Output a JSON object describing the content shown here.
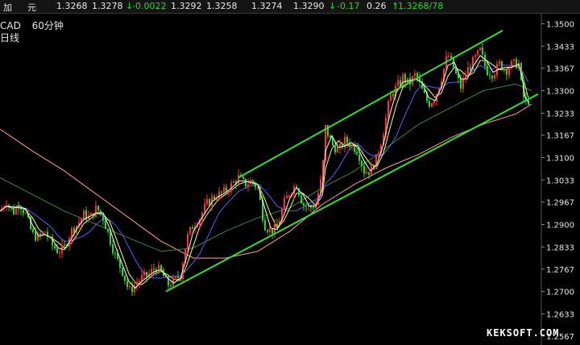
{
  "ticker": {
    "name_a": "加",
    "name_b": "元",
    "fields": [
      "1.3268",
      "1.3278",
      "-0.0022",
      "1.3292",
      "1.3258",
      "1.3274",
      "1.3290",
      "-0.17",
      "0.26",
      "1.3268/78"
    ]
  },
  "chart_header": {
    "symbol": "CAD",
    "timeframe": "60分钟",
    "sublabel": "日线"
  },
  "watermark": "KEKSOFT.COM",
  "colors": {
    "background": "#000000",
    "up_candle": "#ff3030",
    "down_candle": "#29d629",
    "channel": "#30e030",
    "ma_fast": "#ffffff",
    "ma_mid": "#ffff66",
    "ma_slow": "#3a8a3a",
    "ma_long": "#ff9aa0",
    "ma_blue": "#5a5aff",
    "axis_text": "#e6e6e6",
    "grid": "#2a2a2a"
  },
  "chart_data": {
    "type": "candlestick",
    "title": "CAD 60分钟",
    "y_ticks": [
      "1.3500",
      "1.3433",
      "1.3367",
      "1.3300",
      "1.3233",
      "1.3167",
      "1.3100",
      "1.3033",
      "1.2967",
      "1.2900",
      "1.2833",
      "1.2767",
      "1.2700",
      "1.2633",
      "1.2567"
    ],
    "ylim": [
      1.254,
      1.353
    ],
    "close_path": [
      [
        0,
        1.294
      ],
      [
        8,
        1.297
      ],
      [
        16,
        1.2935
      ],
      [
        24,
        1.2965
      ],
      [
        32,
        1.293
      ],
      [
        40,
        1.287
      ],
      [
        48,
        1.286
      ],
      [
        56,
        1.288
      ],
      [
        64,
        1.284
      ],
      [
        72,
        1.282
      ],
      [
        80,
        1.283
      ],
      [
        88,
        1.288
      ],
      [
        96,
        1.29
      ],
      [
        104,
        1.293
      ],
      [
        112,
        1.292
      ],
      [
        120,
        1.295
      ],
      [
        128,
        1.292
      ],
      [
        136,
        1.286
      ],
      [
        144,
        1.28
      ],
      [
        152,
        1.276
      ],
      [
        160,
        1.27
      ],
      [
        168,
        1.272
      ],
      [
        176,
        1.274
      ],
      [
        184,
        1.275
      ],
      [
        192,
        1.277
      ],
      [
        200,
        1.276
      ],
      [
        208,
        1.272
      ],
      [
        216,
        1.273
      ],
      [
        224,
        1.275
      ],
      [
        232,
        1.286
      ],
      [
        240,
        1.29
      ],
      [
        248,
        1.292
      ],
      [
        256,
        1.296
      ],
      [
        264,
        1.298
      ],
      [
        272,
        1.299
      ],
      [
        280,
        1.3
      ],
      [
        288,
        1.302
      ],
      [
        296,
        1.304
      ],
      [
        304,
        1.302
      ],
      [
        312,
        1.303
      ],
      [
        320,
        1.301
      ],
      [
        328,
        1.29
      ],
      [
        336,
        1.288
      ],
      [
        344,
        1.289
      ],
      [
        352,
        1.296
      ],
      [
        360,
        1.3
      ],
      [
        368,
        1.302
      ],
      [
        376,
        1.296
      ],
      [
        384,
        1.295
      ],
      [
        392,
        1.296
      ],
      [
        400,
        1.305
      ],
      [
        404,
        1.319
      ],
      [
        412,
        1.314
      ],
      [
        420,
        1.312
      ],
      [
        428,
        1.315
      ],
      [
        436,
        1.314
      ],
      [
        444,
        1.312
      ],
      [
        452,
        1.306
      ],
      [
        460,
        1.306
      ],
      [
        468,
        1.31
      ],
      [
        476,
        1.318
      ],
      [
        484,
        1.328
      ],
      [
        492,
        1.331
      ],
      [
        500,
        1.334
      ],
      [
        508,
        1.332
      ],
      [
        516,
        1.335
      ],
      [
        524,
        1.33
      ],
      [
        532,
        1.326
      ],
      [
        540,
        1.328
      ],
      [
        548,
        1.334
      ],
      [
        556,
        1.341
      ],
      [
        564,
        1.336
      ],
      [
        572,
        1.331
      ],
      [
        580,
        1.336
      ],
      [
        588,
        1.339
      ],
      [
        596,
        1.342
      ],
      [
        604,
        1.336
      ],
      [
        612,
        1.335
      ],
      [
        620,
        1.338
      ],
      [
        628,
        1.336
      ],
      [
        636,
        1.338
      ],
      [
        644,
        1.338
      ],
      [
        648,
        1.33
      ],
      [
        652,
        1.326
      ],
      [
        656,
        1.327
      ]
    ],
    "channel_upper": [
      [
        296,
        1.304
      ],
      [
        624,
        1.348
      ]
    ],
    "channel_lower": [
      [
        206,
        1.27
      ],
      [
        668,
        1.329
      ]
    ],
    "ma_long_path": [
      [
        0,
        1.3185
      ],
      [
        40,
        1.312
      ],
      [
        80,
        1.306
      ],
      [
        120,
        1.299
      ],
      [
        160,
        1.292
      ],
      [
        200,
        1.285
      ],
      [
        240,
        1.28
      ],
      [
        280,
        1.28
      ],
      [
        320,
        1.282
      ],
      [
        360,
        1.288
      ],
      [
        400,
        1.296
      ],
      [
        440,
        1.302
      ],
      [
        480,
        1.307
      ],
      [
        520,
        1.311
      ],
      [
        560,
        1.316
      ],
      [
        600,
        1.32
      ],
      [
        640,
        1.323
      ],
      [
        660,
        1.326
      ]
    ],
    "ma_slow_path": [
      [
        0,
        1.304
      ],
      [
        40,
        1.299
      ],
      [
        80,
        1.294
      ],
      [
        120,
        1.29
      ],
      [
        160,
        1.286
      ],
      [
        200,
        1.282
      ],
      [
        240,
        1.283
      ],
      [
        280,
        1.288
      ],
      [
        320,
        1.292
      ],
      [
        360,
        1.295
      ],
      [
        400,
        1.301
      ],
      [
        440,
        1.306
      ],
      [
        480,
        1.313
      ],
      [
        520,
        1.32
      ],
      [
        560,
        1.325
      ],
      [
        600,
        1.33
      ],
      [
        640,
        1.332
      ],
      [
        660,
        1.33
      ]
    ]
  }
}
